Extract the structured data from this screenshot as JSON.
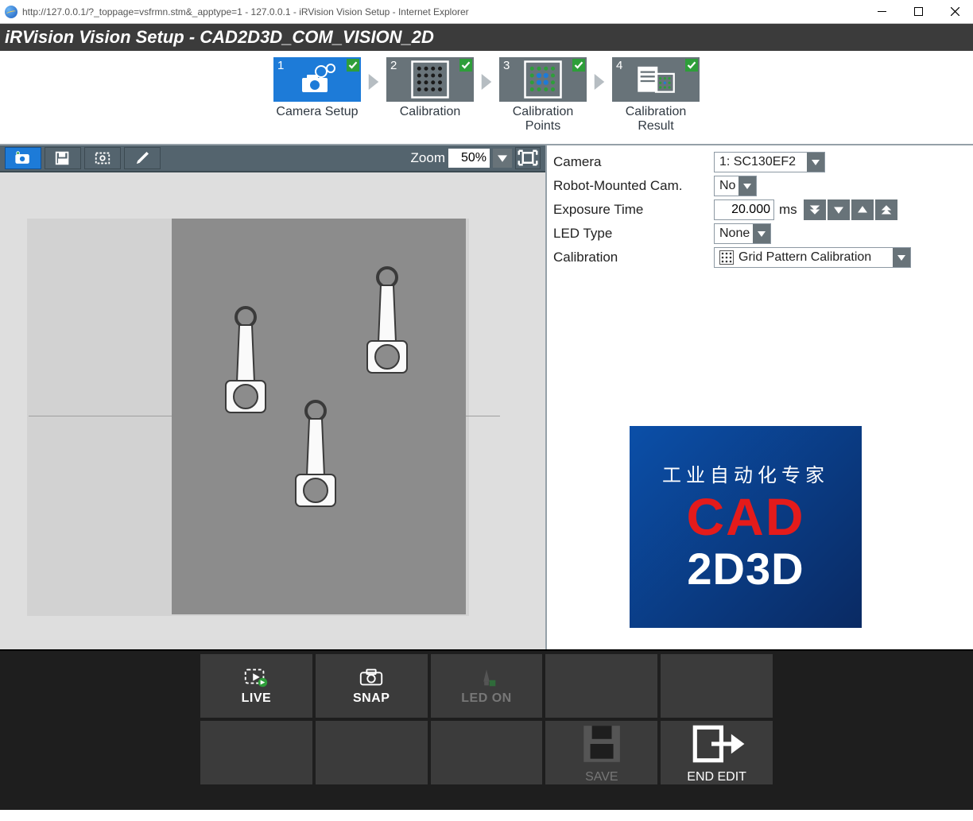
{
  "window": {
    "url": "http://127.0.0.1/?_toppage=vsfrmn.stm&_apptype=1 - 127.0.0.1 - iRVision Vision Setup - Internet Explorer"
  },
  "header": {
    "title": "iRVision Vision Setup - CAD2D3D_COM_VISION_2D"
  },
  "wizard": {
    "steps": [
      {
        "num": "1",
        "label": "Camera Setup",
        "done": true,
        "active": true
      },
      {
        "num": "2",
        "label": "Calibration",
        "done": true,
        "active": false
      },
      {
        "num": "3",
        "label": "Calibration Points",
        "done": true,
        "active": false
      },
      {
        "num": "4",
        "label": "Calibration Result",
        "done": true,
        "active": false
      }
    ]
  },
  "imageToolbar": {
    "zoomLabel": "Zoom",
    "zoomValue": "50%"
  },
  "props": {
    "camera": {
      "label": "Camera",
      "value": "1: SC130EF2"
    },
    "robotMounted": {
      "label": "Robot-Mounted Cam.",
      "value": "No"
    },
    "exposure": {
      "label": "Exposure Time",
      "value": "20.000",
      "unit": "ms"
    },
    "ledType": {
      "label": "LED Type",
      "value": "None"
    },
    "calibration": {
      "label": "Calibration",
      "value": "Grid Pattern Calibration"
    }
  },
  "logo": {
    "line1": "工业自动化专家",
    "line2": "CAD",
    "line3": "2D3D"
  },
  "bottom": {
    "live": "LIVE",
    "snap": "SNAP",
    "ledOn": "LED ON",
    "save": "SAVE",
    "endEdit": "END EDIT"
  }
}
